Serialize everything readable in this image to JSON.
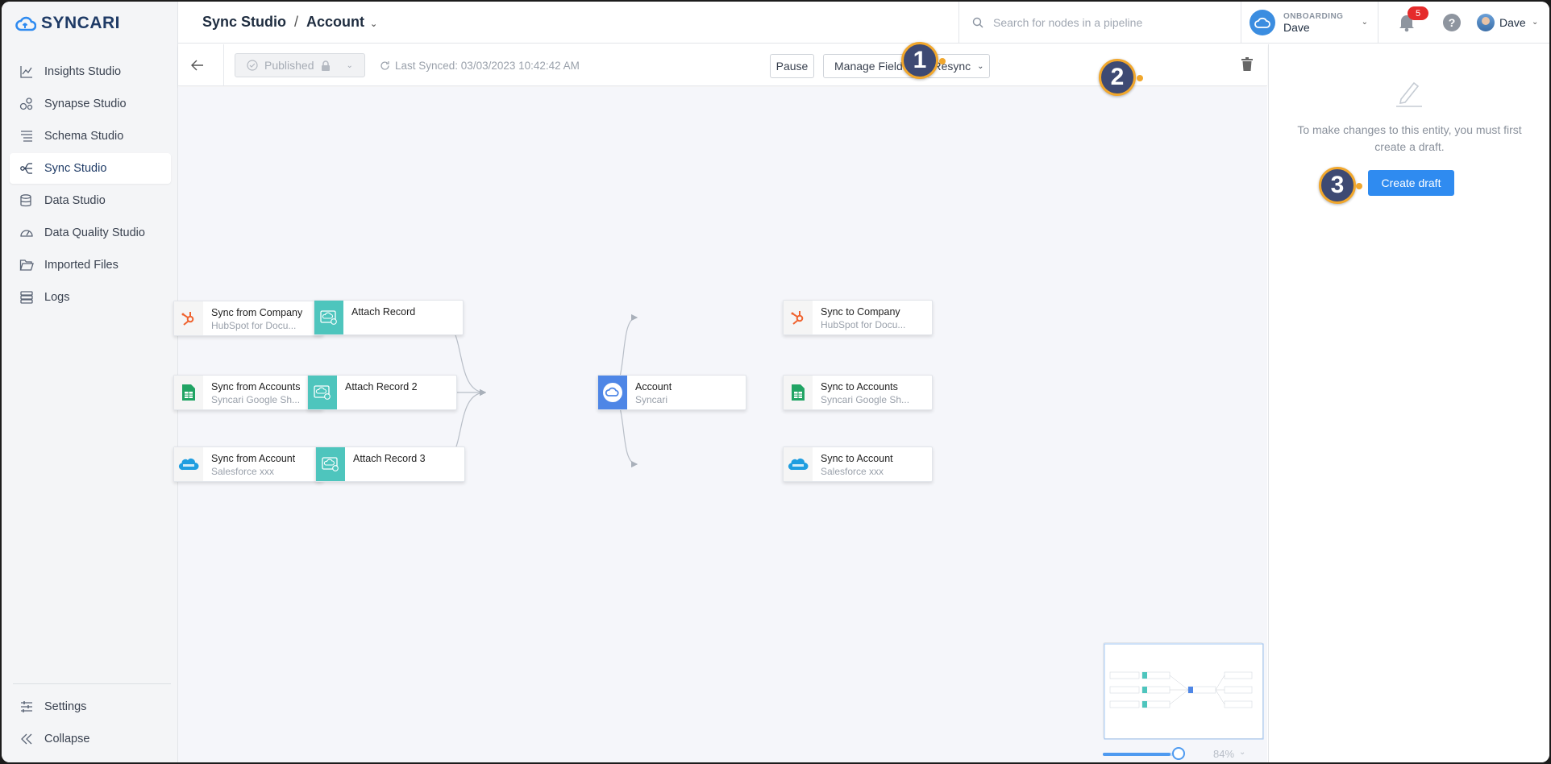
{
  "brand": {
    "name": "SYNCARI",
    "accent": "#2f8bf0"
  },
  "sidebar": {
    "items": [
      {
        "label": "Insights Studio",
        "icon": "chart-icon"
      },
      {
        "label": "Synapse Studio",
        "icon": "synapse-icon"
      },
      {
        "label": "Schema Studio",
        "icon": "schema-icon"
      },
      {
        "label": "Sync Studio",
        "icon": "sync-flow-icon",
        "active": true
      },
      {
        "label": "Data Studio",
        "icon": "database-icon"
      },
      {
        "label": "Data Quality Studio",
        "icon": "gauge-icon"
      },
      {
        "label": "Imported Files",
        "icon": "folder-icon"
      },
      {
        "label": "Logs",
        "icon": "logs-icon"
      }
    ],
    "bottom": [
      {
        "label": "Settings",
        "icon": "sliders-icon"
      },
      {
        "label": "Collapse",
        "icon": "double-chevron-left-icon"
      }
    ]
  },
  "header": {
    "breadcrumb_root": "Sync Studio",
    "breadcrumb_sep": "/",
    "breadcrumb_current": "Account",
    "search_placeholder": "Search for nodes in a pipeline",
    "org_label": "ONBOARDING",
    "org_name": "Dave",
    "notification_count": "5",
    "help": "?",
    "user_name": "Dave"
  },
  "toolbar": {
    "status": "Published",
    "last_synced": "Last Synced: 03/03/2023 10:42:42 AM",
    "pause": "Pause",
    "manage_field": "Manage Field Ma",
    "resync": "Resync"
  },
  "pipeline": {
    "sources": [
      {
        "title": "Sync from  Company",
        "sub": "HubSpot for Docu...",
        "icon": "hubspot-icon"
      },
      {
        "title": "Sync from  Accounts",
        "sub": "Syncari Google Sh...",
        "icon": "google-sheets-icon"
      },
      {
        "title": "Sync from  Account",
        "sub": "Salesforce xxx",
        "icon": "salesforce-icon"
      }
    ],
    "attach": [
      {
        "title": "Attach Record"
      },
      {
        "title": "Attach Record 2"
      },
      {
        "title": "Attach Record 3"
      }
    ],
    "entity": {
      "title": "Account",
      "sub": "Syncari"
    },
    "targets": [
      {
        "title": "Sync to  Company",
        "sub": "HubSpot for Docu...",
        "icon": "hubspot-icon"
      },
      {
        "title": "Sync to  Accounts",
        "sub": "Syncari Google Sh...",
        "icon": "google-sheets-icon"
      },
      {
        "title": "Sync to  Account",
        "sub": "Salesforce xxx",
        "icon": "salesforce-icon"
      }
    ]
  },
  "zoom": {
    "value": "84%",
    "fraction": 0.84
  },
  "panel": {
    "message": "To make changes to this entity, you must first create a draft.",
    "create_draft": "Create draft"
  },
  "callouts": [
    "1",
    "2",
    "3"
  ]
}
